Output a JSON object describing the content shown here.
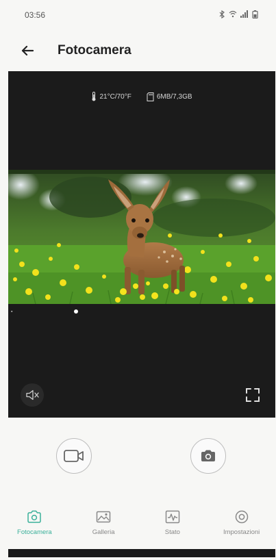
{
  "status_bar": {
    "time": "03:56",
    "icons": [
      "bluetooth-icon",
      "wifi-icon",
      "signal-icon",
      "battery-icon"
    ]
  },
  "app_bar": {
    "title": "Fotocamera"
  },
  "camera": {
    "temperature": "21°C/70°F",
    "storage": "6MB/7,3GB",
    "timestamp": "",
    "preview_subject": "deer-fawn-in-flowers"
  },
  "controls": {
    "video_icon": "video-camera-icon",
    "photo_icon": "camera-icon"
  },
  "bottom_nav": {
    "items": [
      {
        "label": "Fotocamera",
        "icon": "camera-icon",
        "active": true
      },
      {
        "label": "Galleria",
        "icon": "gallery-icon",
        "active": false
      },
      {
        "label": "Stato",
        "icon": "status-icon",
        "active": false
      },
      {
        "label": "Impostazioni",
        "icon": "gear-icon",
        "active": false
      }
    ]
  },
  "colors": {
    "accent": "#3ab09a",
    "camera_bg": "#1b1b1b",
    "page_bg": "#f7f7f5"
  }
}
